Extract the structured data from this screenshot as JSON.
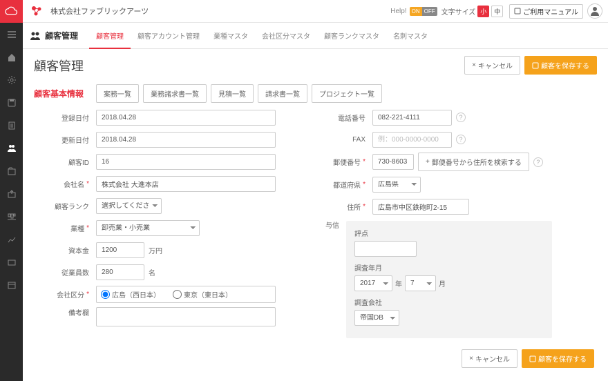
{
  "topbar": {
    "company": "株式会社ファブリックアーツ",
    "help": "Help!",
    "on": "ON",
    "off": "OFF",
    "fontsize_label": "文字サイズ",
    "size_small": "小",
    "size_mid": "中",
    "manual": "ご利用マニュアル"
  },
  "module": {
    "title": "顧客管理",
    "tabs": [
      "顧客管理",
      "顧客アカウント管理",
      "業種マスタ",
      "会社区分マスタ",
      "顧客ランクマスタ",
      "名刺マスタ"
    ]
  },
  "page": {
    "title": "顧客管理",
    "cancel": "キャンセル",
    "save": "顧客を保存する"
  },
  "section": {
    "title": "顧客基本情報",
    "tabs": [
      "案務一覧",
      "業務諸求書一覧",
      "見積一覧",
      "請求書一覧",
      "プロジェクト一覧"
    ]
  },
  "form": {
    "reg_date": {
      "label": "登録日付",
      "value": "2018.04.28"
    },
    "upd_date": {
      "label": "更新日付",
      "value": "2018.04.28"
    },
    "cust_id": {
      "label": "顧客ID",
      "value": "16"
    },
    "company": {
      "label": "会社名",
      "value": "株式会社 大進本店"
    },
    "rank": {
      "label": "顧客ランク",
      "value": "選択してください"
    },
    "industry": {
      "label": "業種",
      "value": "卸売業・小売業"
    },
    "capital": {
      "label": "資本金",
      "value": "1200",
      "unit": "万円"
    },
    "employees": {
      "label": "従業員数",
      "value": "280",
      "unit": "名"
    },
    "division": {
      "label": "会社区分",
      "opt1": "広島（西日本）",
      "opt2": "東京（東日本）"
    },
    "note": {
      "label": "備考欄",
      "value": ""
    },
    "tel": {
      "label": "電話番号",
      "value": "082-221-4111"
    },
    "fax": {
      "label": "FAX",
      "placeholder": "例：000-0000-0000"
    },
    "zip": {
      "label": "郵便番号",
      "value": "730-8603",
      "search": "郵便番号から住所を検索する"
    },
    "pref": {
      "label": "都道府県",
      "value": "広島県"
    },
    "addr": {
      "label": "住所",
      "value": "広島市中区鉄砲町2-15"
    },
    "credit": {
      "label": "与信",
      "score_label": "評点",
      "score": "",
      "ym_label": "調査年月",
      "year": "2017",
      "year_unit": "年",
      "month": "7",
      "month_unit": "月",
      "company_label": "調査会社",
      "company": "帝国DB"
    }
  },
  "footer": {
    "cancel": "キャンセル",
    "save": "顧客を保存する"
  }
}
